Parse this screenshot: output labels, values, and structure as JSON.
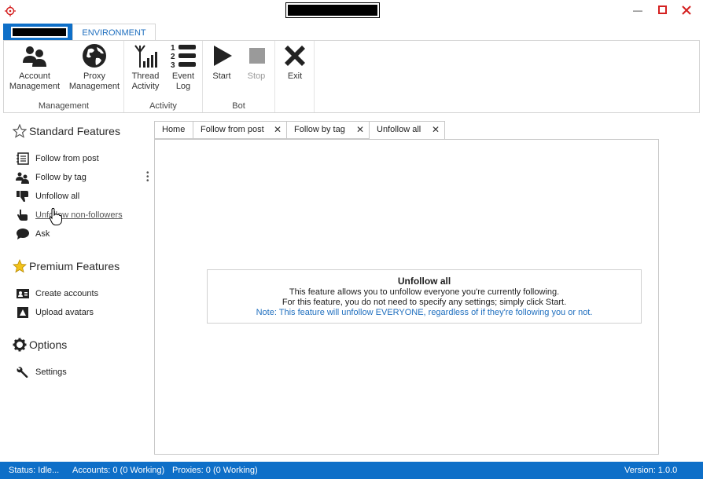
{
  "titlebar": {
    "minimize": "—",
    "maximize": "□",
    "close": "✕"
  },
  "ribbon": {
    "tab_label": "ENVIRONMENT",
    "groups": {
      "management": {
        "label": "Management",
        "account_label": "Account\nManagement",
        "proxy_label": "Proxy\nManagement"
      },
      "activity": {
        "label": "Activity",
        "thread_label": "Thread\nActivity",
        "event_label": "Event\nLog"
      },
      "bot": {
        "label": "Bot",
        "start_label": "Start",
        "stop_label": "Stop"
      },
      "exit": {
        "exit_label": "Exit"
      }
    }
  },
  "sidebar": {
    "standard_title": "Standard Features",
    "standard_items": [
      "Follow from post",
      "Follow by tag",
      "Unfollow all",
      "Unfollow non-followers",
      "Ask"
    ],
    "premium_title": "Premium Features",
    "premium_items": [
      "Create accounts",
      "Upload avatars"
    ],
    "options_title": "Options",
    "options_items": [
      "Settings"
    ]
  },
  "doc_tabs": [
    {
      "label": "Home",
      "closable": false
    },
    {
      "label": "Follow from post",
      "closable": true
    },
    {
      "label": "Follow by tag",
      "closable": true
    },
    {
      "label": "Unfollow all",
      "closable": true,
      "active": true
    }
  ],
  "content": {
    "title": "Unfollow all",
    "line1": "This feature allows you to unfollow everyone you're currently following.",
    "line2": "For this feature, you do not need to specify any settings; simply click Start.",
    "note": "Note: This feature will unfollow EVERYONE, regardless of if they're following you or not."
  },
  "status": {
    "status": "Status: Idle...",
    "accounts": "Accounts: 0 (0 Working)",
    "proxies": "Proxies: 0 (0 Working)",
    "version": "Version: 1.0.0"
  },
  "colors": {
    "accent": "#0e6fc8",
    "link": "#1f6fbf"
  }
}
